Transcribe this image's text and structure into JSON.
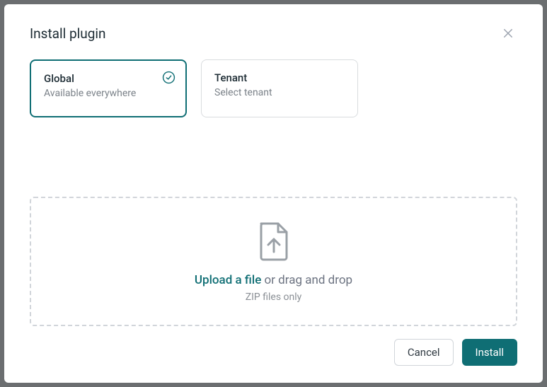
{
  "modal": {
    "title": "Install plugin"
  },
  "scope": {
    "global": {
      "title": "Global",
      "subtitle": "Available everywhere",
      "selected": true
    },
    "tenant": {
      "title": "Tenant",
      "subtitle": "Select tenant",
      "selected": false
    }
  },
  "dropzone": {
    "link_text": "Upload a file",
    "rest_text": " or drag and drop",
    "subtext": "ZIP files only"
  },
  "footer": {
    "cancel": "Cancel",
    "install": "Install"
  },
  "colors": {
    "accent": "#0f6e74"
  }
}
